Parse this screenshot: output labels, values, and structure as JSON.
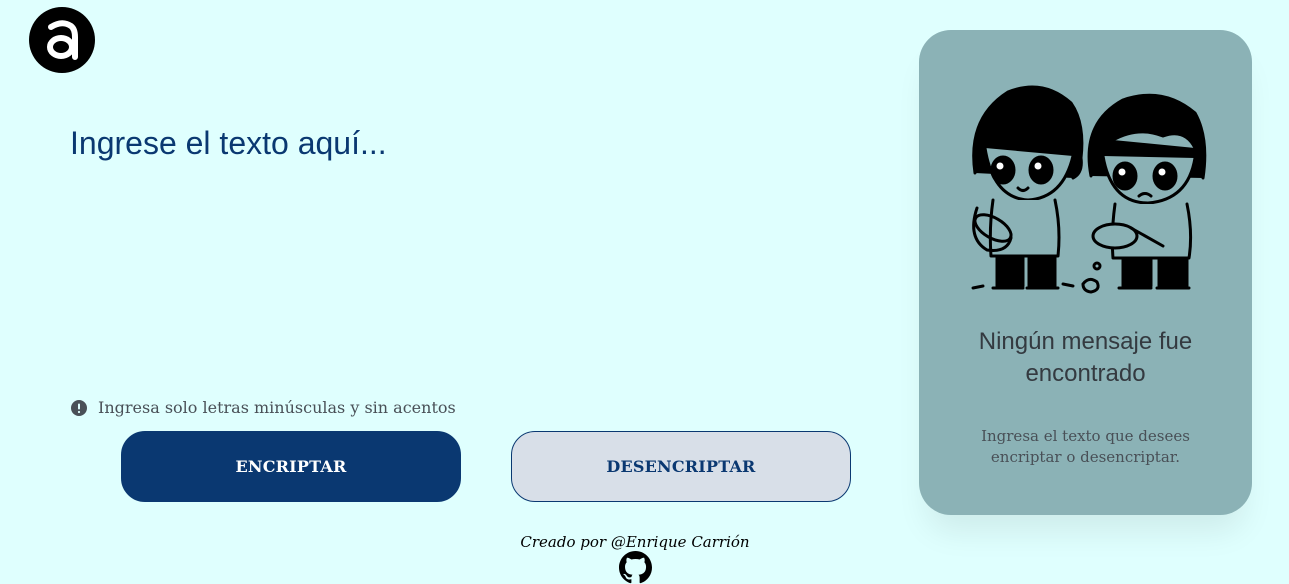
{
  "brand": {
    "logo_icon": "alura-logo-icon"
  },
  "input": {
    "placeholder": "Ingrese el texto aquí..."
  },
  "hint": {
    "icon": "exclamation-circle-icon",
    "text": "Ingresa solo letras minúsculas y sin acentos"
  },
  "buttons": {
    "encrypt": "ENCRIPTAR",
    "decrypt": "DESENCRIPTAR"
  },
  "footer": {
    "credit": "Creado por @Enrique Carrión",
    "icon": "github-icon"
  },
  "output_panel": {
    "illustration": "chibi-detectives-magnifying-glass-illustration",
    "title": "Ningún mensaje fue encontrado",
    "subtitle": "Ingresa el texto que desees encriptar o desencriptar."
  },
  "colors": {
    "background": "#dffffe",
    "primary": "#0a3871",
    "secondary_button": "#d8dfe8",
    "panel": "#8bb2b6"
  }
}
